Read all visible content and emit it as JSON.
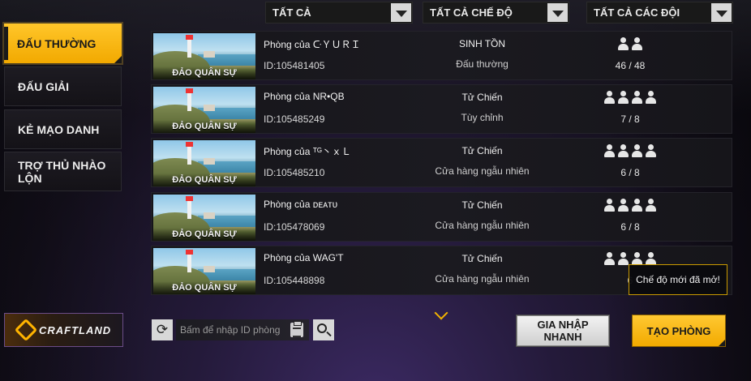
{
  "filters": {
    "all": "TẤT CẢ",
    "all_modes": "TẤT CẢ CHẾ ĐỘ",
    "all_teams": "TẤT CẢ CÁC ĐỘI"
  },
  "nav": {
    "items": [
      {
        "label": "ĐẤU THƯỜNG"
      },
      {
        "label": "ĐẤU GIẢI"
      },
      {
        "label": "KẺ MẠO DANH"
      },
      {
        "label": "TRỢ THỦ NHÀO LỘN"
      }
    ]
  },
  "rooms": [
    {
      "map": "ĐẢO QUÂN SỰ",
      "name": "Phòng của ᑢＹＵＲＩ",
      "id": "ID:105481405",
      "mode": "SINH TỒN",
      "submode": "Đấu thường",
      "count": "46 / 48",
      "player_icons": 2
    },
    {
      "map": "ĐẢO QUÂN SỰ",
      "name": "Phòng của NR•QB",
      "id": "ID:105485249",
      "mode": "Tử Chiến",
      "submode": "Tùy chỉnh",
      "count": "7 / 8",
      "player_icons": 4
    },
    {
      "map": "ĐẢO QUÂN SỰ",
      "name": "Phòng của ᵀᴳ丶ｘＬ",
      "id": "ID:105485210",
      "mode": "Tử Chiến",
      "submode": "Cửa hàng ngẫu nhiên",
      "count": "6 / 8",
      "player_icons": 4
    },
    {
      "map": "ĐẢO QUÂN SỰ",
      "name": "Phòng của ᴅᴇᴀᴛᴜ",
      "id": "ID:105478069",
      "mode": "Tử Chiến",
      "submode": "Cửa hàng ngẫu nhiên",
      "count": "6 / 8",
      "player_icons": 4
    },
    {
      "map": "ĐẢO QUÂN SỰ",
      "name": "Phòng của WAG'T",
      "id": "ID:105448898",
      "mode": "Tử Chiến",
      "submode": "Cửa hàng ngẫu nhiên",
      "count": "6",
      "player_icons": 4
    }
  ],
  "craftland": {
    "label": "CRAFTLAND"
  },
  "search": {
    "placeholder": "Bấm để nhập ID phòng"
  },
  "buttons": {
    "quick_join": "GIA NHẬP NHANH",
    "create_room": "TẠO PHÒNG"
  },
  "tooltip": {
    "text": "Chế độ mới đã mở!"
  },
  "icons": {
    "dropdown": "triangle-down-icon",
    "player": "person-icon",
    "refresh": "refresh-icon",
    "paste": "clipboard-icon",
    "search": "search-icon",
    "more": "chevron-down-icon"
  },
  "colors": {
    "accent": "#f5b400",
    "panel": "#17161b"
  }
}
